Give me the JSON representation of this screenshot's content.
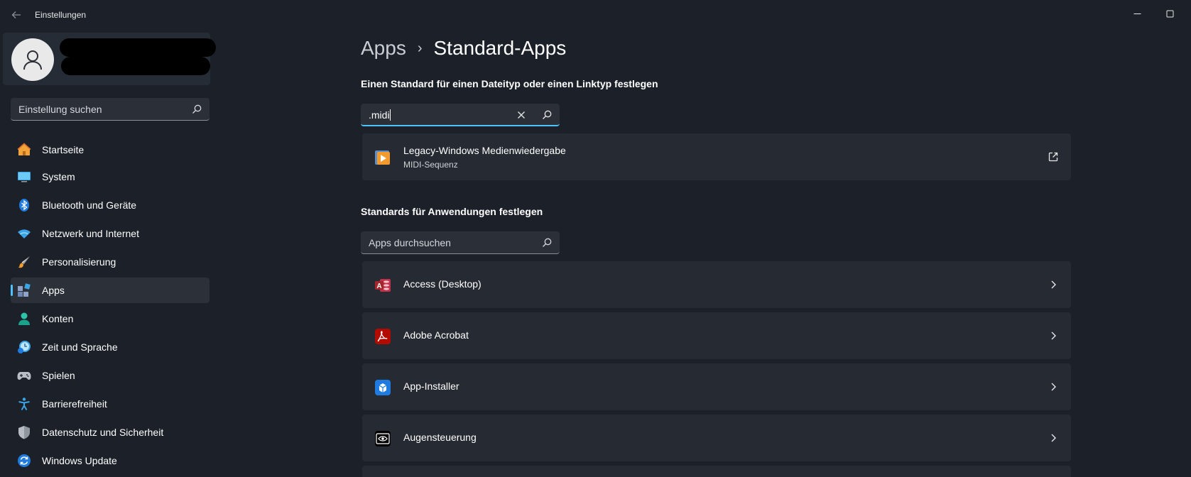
{
  "window": {
    "title": "Einstellungen"
  },
  "sidebar": {
    "search_placeholder": "Einstellung suchen",
    "items": [
      {
        "label": "Startseite",
        "icon": "home-icon"
      },
      {
        "label": "System",
        "icon": "monitor-icon"
      },
      {
        "label": "Bluetooth und Geräte",
        "icon": "bluetooth-icon"
      },
      {
        "label": "Netzwerk und Internet",
        "icon": "wifi-icon"
      },
      {
        "label": "Personalisierung",
        "icon": "brush-icon"
      },
      {
        "label": "Apps",
        "icon": "apps-icon",
        "selected": true
      },
      {
        "label": "Konten",
        "icon": "person-icon"
      },
      {
        "label": "Zeit und Sprache",
        "icon": "clock-globe-icon"
      },
      {
        "label": "Spielen",
        "icon": "gamepad-icon"
      },
      {
        "label": "Barrierefreiheit",
        "icon": "accessibility-icon"
      },
      {
        "label": "Datenschutz und Sicherheit",
        "icon": "shield-icon"
      },
      {
        "label": "Windows Update",
        "icon": "update-icon"
      }
    ]
  },
  "main": {
    "breadcrumb": {
      "parent": "Apps",
      "current": "Standard-Apps"
    },
    "filetype_section_label": "Einen Standard für einen Dateityp oder einen Linktyp festlegen",
    "filetype_search_value": ".midi",
    "result": {
      "title": "Legacy-Windows Medienwiedergabe",
      "subtitle": "MIDI-Sequenz"
    },
    "apps_section_label": "Standards für Anwendungen festlegen",
    "apps_search_placeholder": "Apps durchsuchen",
    "apps": [
      {
        "label": "Access (Desktop)",
        "icon": "access-icon"
      },
      {
        "label": "Adobe Acrobat",
        "icon": "acrobat-icon"
      },
      {
        "label": "App-Installer",
        "icon": "app-installer-icon"
      },
      {
        "label": "Augensteuerung",
        "icon": "eye-control-icon"
      }
    ]
  },
  "colors": {
    "background": "#1b2029",
    "card": "#262b33",
    "accent": "#4cc2ff"
  }
}
